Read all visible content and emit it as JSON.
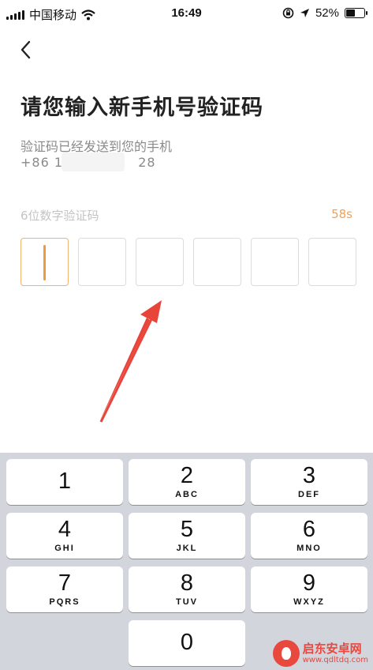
{
  "status_bar": {
    "carrier": "中国移动",
    "time": "16:49",
    "battery_percent": "52%",
    "battery_level": 0.52
  },
  "page": {
    "title": "请您输入新手机号验证码",
    "subtitle": "验证码已经发送到您的手机",
    "phone_prefix": "+86 17",
    "phone_suffix": "28",
    "code_label": "6位数字验证码",
    "countdown": "58s",
    "code_length": 6
  },
  "keypad": {
    "keys": [
      {
        "digit": "1",
        "letters": ""
      },
      {
        "digit": "2",
        "letters": "ABC"
      },
      {
        "digit": "3",
        "letters": "DEF"
      },
      {
        "digit": "4",
        "letters": "GHI"
      },
      {
        "digit": "5",
        "letters": "JKL"
      },
      {
        "digit": "6",
        "letters": "MNO"
      },
      {
        "digit": "7",
        "letters": "PQRS"
      },
      {
        "digit": "8",
        "letters": "TUV"
      },
      {
        "digit": "9",
        "letters": "WXYZ"
      },
      {
        "digit": "0",
        "letters": ""
      }
    ]
  },
  "watermark": {
    "name": "启东安卓网",
    "url": "www.qdltdq.com"
  },
  "colors": {
    "accent": "#ef9a3c",
    "annotation_arrow": "#e8443a"
  }
}
